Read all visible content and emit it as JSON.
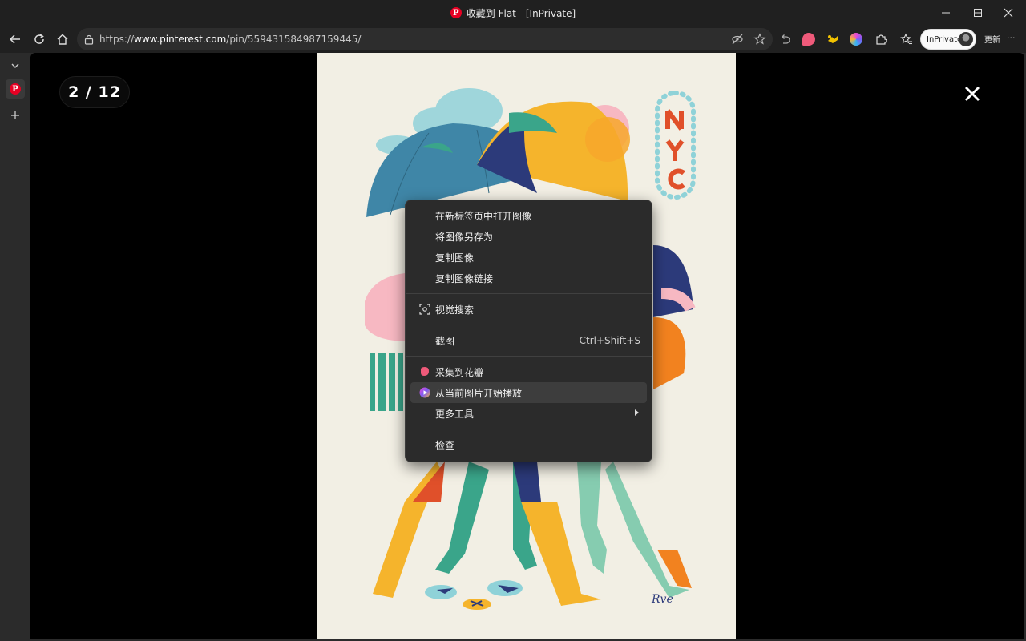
{
  "window": {
    "title": "收藏到 Flat - [InPrivate]",
    "minimize_icon": "minimize-icon",
    "maximize_icon": "maximize-icon",
    "close_icon": "close-icon"
  },
  "toolbar": {
    "url_prefix": "https://",
    "url_domain": "www.pinterest.com",
    "url_path": "/pin/559431584987159445/",
    "inprivate_label": "InPrivate",
    "update_label": "更新",
    "more_label": "···"
  },
  "sidebar": {
    "collapse_icon": "chevron-down-icon",
    "tab_icon": "pinterest-icon",
    "new_tab_icon": "plus-icon"
  },
  "viewer": {
    "counter": "2 / 12",
    "signature": "Rve"
  },
  "context_menu": {
    "open_in_new_tab": "在新标签页中打开图像",
    "save_image_as": "将图像另存为",
    "copy_image": "复制图像",
    "copy_image_link": "复制图像链接",
    "visual_search": "视觉搜索",
    "screenshot": "截图",
    "screenshot_shortcut": "Ctrl+Shift+S",
    "collect_to_huaban": "采集到花瓣",
    "start_slideshow": "从当前图片开始播放",
    "more_tools": "更多工具",
    "inspect": "检查"
  },
  "colors": {
    "accent_pinterest": "#e60023",
    "menu_bg": "#2b2b2b",
    "menu_highlight": "#3d3d3d",
    "viewport_bg": "#000000",
    "art_bg": "#f2efe4"
  }
}
